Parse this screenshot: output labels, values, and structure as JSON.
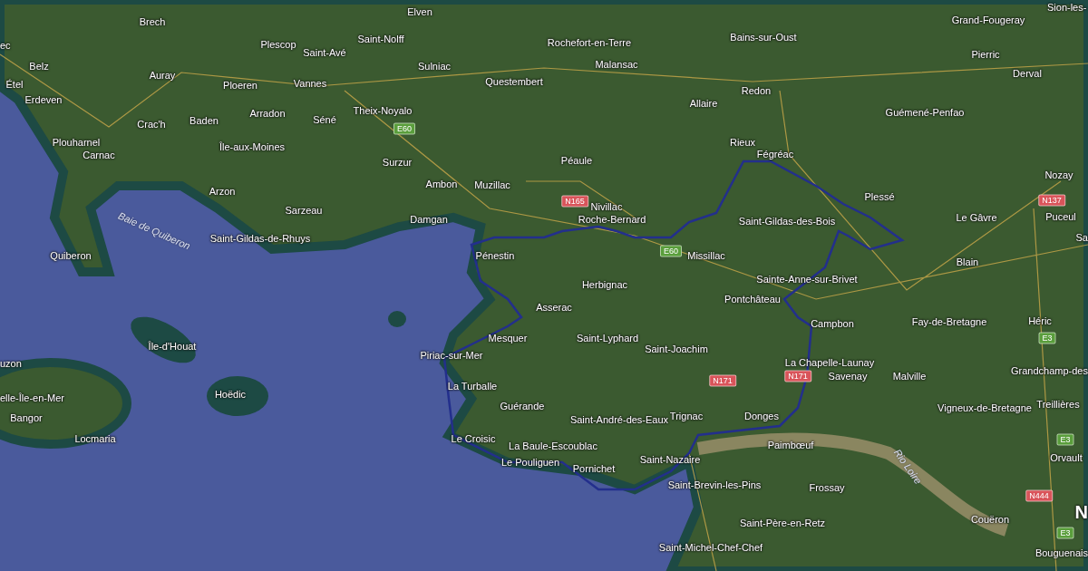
{
  "map": {
    "places": [
      {
        "label": "Brech"
      },
      {
        "label": "Elven"
      },
      {
        "label": "Plescop"
      },
      {
        "label": "Saint-Avé"
      },
      {
        "label": "Saint-Nolff"
      },
      {
        "label": "Rochefort-en-Terre"
      },
      {
        "label": "Bains-sur-Oust"
      },
      {
        "label": "Grand-Fougeray"
      },
      {
        "label": "Sion-les-"
      },
      {
        "label": "ec"
      },
      {
        "label": "Belz"
      },
      {
        "label": "Auray"
      },
      {
        "label": "Ploeren"
      },
      {
        "label": "Vannes"
      },
      {
        "label": "Sulniac"
      },
      {
        "label": "Questembert"
      },
      {
        "label": "Malansac"
      },
      {
        "label": "Redon"
      },
      {
        "label": "Pierric"
      },
      {
        "label": "Derval"
      },
      {
        "label": "Étel"
      },
      {
        "label": "Erdeven"
      },
      {
        "label": "Arradon"
      },
      {
        "label": "Baden"
      },
      {
        "label": "Crac'h"
      },
      {
        "label": "Séné"
      },
      {
        "label": "Theix-Noyalo"
      },
      {
        "label": "Allaire"
      },
      {
        "label": "Guémené-Penfao"
      },
      {
        "label": "Plouharnel"
      },
      {
        "label": "Carnac"
      },
      {
        "label": "Île-aux-Moines"
      },
      {
        "label": "Rieux"
      },
      {
        "label": "Fégréac"
      },
      {
        "label": "Nozay"
      },
      {
        "label": "Surzur"
      },
      {
        "label": "Péaule"
      },
      {
        "label": "Arzon"
      },
      {
        "label": "Sarzeau"
      },
      {
        "label": "Ambon"
      },
      {
        "label": "Muzillac"
      },
      {
        "label": "Nivillac"
      },
      {
        "label": "Roche-Bernard"
      },
      {
        "label": "Plessé"
      },
      {
        "label": "Le Gâvre"
      },
      {
        "label": "Puceul"
      },
      {
        "label": "Sa"
      },
      {
        "label": "Saint-Gildas-des-Bois"
      },
      {
        "label": "Saint-Gildas-de-Rhuys"
      },
      {
        "label": "Damgan"
      },
      {
        "label": "Quiberon"
      },
      {
        "label": "Pénestin"
      },
      {
        "label": "Missillac"
      },
      {
        "label": "Blain"
      },
      {
        "label": "Sainte-Anne-sur-Brivet"
      },
      {
        "label": "Herbignac"
      },
      {
        "label": "Pontchâteau"
      },
      {
        "label": "Asserac"
      },
      {
        "label": "Campbon"
      },
      {
        "label": "Fay-de-Bretagne"
      },
      {
        "label": "Héric"
      },
      {
        "label": "Île-d'Houat"
      },
      {
        "label": "Mesquer"
      },
      {
        "label": "Saint-Lyphard"
      },
      {
        "label": "Saint-Joachim"
      },
      {
        "label": "uzon"
      },
      {
        "label": "Piriac-sur-Mer"
      },
      {
        "label": "La Chapelle-Launay"
      },
      {
        "label": "Savenay"
      },
      {
        "label": "Malville"
      },
      {
        "label": "Grandchamp-des"
      },
      {
        "label": "Hoëdic"
      },
      {
        "label": "elle-Île-en-Mer"
      },
      {
        "label": "La Turballe"
      },
      {
        "label": "Guérande"
      },
      {
        "label": "Bangor"
      },
      {
        "label": "Saint-André-des-Eaux"
      },
      {
        "label": "Trignac"
      },
      {
        "label": "Vigneux-de-Bretagne"
      },
      {
        "label": "Treillières"
      },
      {
        "label": "Donges"
      },
      {
        "label": "Le Croisic"
      },
      {
        "label": "Locmaria"
      },
      {
        "label": "La Baule-Escoublac"
      },
      {
        "label": "Paimbœuf"
      },
      {
        "label": "Orvault"
      },
      {
        "label": "Le Pouliguen"
      },
      {
        "label": "Saint-Nazaire"
      },
      {
        "label": "Pornichet"
      },
      {
        "label": "Frossay"
      },
      {
        "label": "Saint-Brevin-les-Pins"
      },
      {
        "label": "N"
      },
      {
        "label": "Couëron"
      },
      {
        "label": "Saint-Père-en-Retz"
      },
      {
        "label": "Saint-Michel-Chef-Chef"
      },
      {
        "label": "Bouguenais"
      }
    ],
    "water_labels": [
      {
        "label": "Baie de Quiberon"
      },
      {
        "label": "Rio Loire"
      }
    ],
    "road_shields": [
      {
        "label": "E60",
        "color": "#5a9e3c"
      },
      {
        "label": "N165",
        "color": "#d9545a"
      },
      {
        "label": "E60",
        "color": "#5a9e3c"
      },
      {
        "label": "N137",
        "color": "#d9545a"
      },
      {
        "label": "N171",
        "color": "#d9545a"
      },
      {
        "label": "N171",
        "color": "#d9545a"
      },
      {
        "label": "E3",
        "color": "#5a9e3c"
      },
      {
        "label": "E3",
        "color": "#5a9e3c"
      },
      {
        "label": "N444",
        "color": "#d9545a"
      },
      {
        "label": "E3",
        "color": "#5a9e3c"
      }
    ]
  }
}
